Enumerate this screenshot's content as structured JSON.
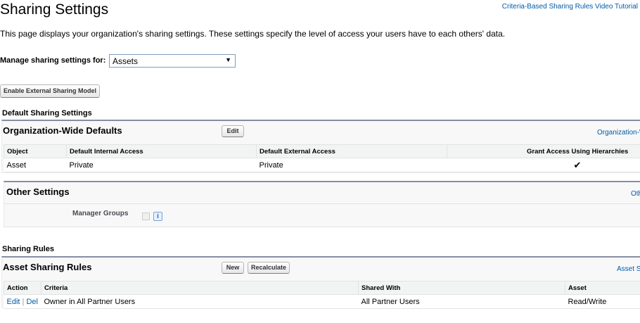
{
  "page": {
    "title": "Sharing Settings",
    "video_link": "Criteria-Based Sharing Rules Video Tutorial",
    "description": "This page displays your organization's sharing settings. These settings specify the level of access your users have to each others' data."
  },
  "manage": {
    "label": "Manage sharing settings for:",
    "selected": "Assets",
    "arrow": "▼"
  },
  "enable_button": "Enable External Sharing Model",
  "default_section": {
    "header": "Default Sharing Settings",
    "org_panel": {
      "title": "Organization-Wide Defaults",
      "edit_label": "Edit",
      "link": "Organization-W",
      "columns": [
        "Object",
        "Default Internal Access",
        "Default External Access",
        "Grant Access Using Hierarchies"
      ],
      "rows": [
        {
          "object": "Asset",
          "internal": "Private",
          "external": "Private",
          "grant": "✔"
        }
      ]
    },
    "other_panel": {
      "title": "Other Settings",
      "link": "Oth",
      "manager_groups_label": "Manager Groups",
      "info": "i"
    }
  },
  "rules_section": {
    "header": "Sharing Rules",
    "asset_panel": {
      "title": "Asset Sharing Rules",
      "new_label": "New",
      "recalc_label": "Recalculate",
      "link": "Asset S",
      "columns": [
        "Action",
        "Criteria",
        "Shared With",
        "Asset"
      ],
      "rows": [
        {
          "edit": "Edit",
          "sep": "|",
          "del": "Del",
          "criteria": "Owner in All Partner Users",
          "shared_with": "All Partner Users",
          "access": "Read/Write"
        }
      ]
    }
  }
}
